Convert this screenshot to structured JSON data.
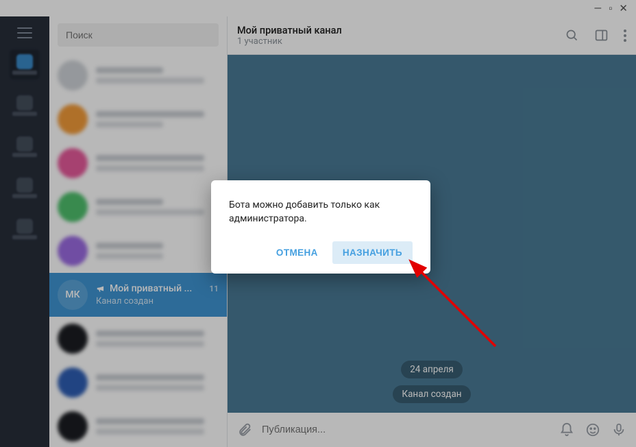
{
  "window_controls": {
    "min": "—",
    "max": "▫",
    "close": "✕"
  },
  "search": {
    "placeholder": "Поиск"
  },
  "selected_chat": {
    "avatar_initials": "МК",
    "title": "Мой приватный ...",
    "time": "11",
    "subtitle": "Канал создан"
  },
  "header": {
    "title": "Мой приватный канал",
    "subtitle": "1 участник"
  },
  "body": {
    "date_pill": "24 апреля",
    "service_pill": "Канал создан"
  },
  "composer": {
    "placeholder": "Публикация..."
  },
  "modal": {
    "text": "Бота можно добавить только как администратора.",
    "cancel": "ОТМЕНА",
    "confirm": "НАЗНАЧИТЬ"
  },
  "avatar_colors": [
    "#cfd3d8",
    "#f39c3a",
    "#e75a9b",
    "#4fc06d",
    "#9b6be2",
    "#5aa4d9",
    "#1b1d22",
    "#2f5fb5",
    "#1b1d22",
    "#cfd3d8"
  ]
}
